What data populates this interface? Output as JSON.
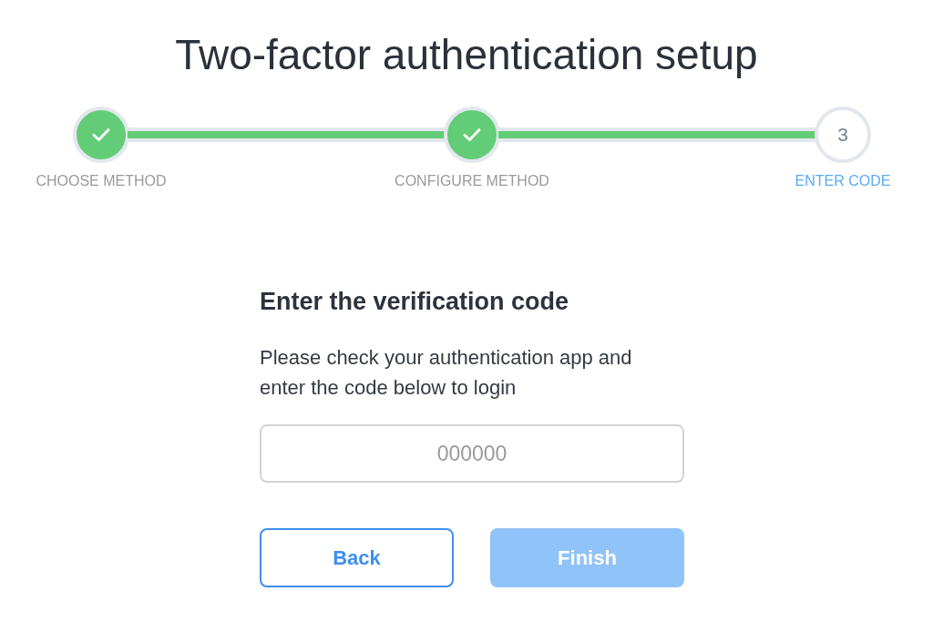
{
  "title": "Two-factor authentication setup",
  "stepper": {
    "steps": [
      {
        "label": "CHOOSE METHOD",
        "completed": true,
        "selected": false
      },
      {
        "label": "CONFIGURE METHOD",
        "completed": true,
        "selected": false
      },
      {
        "label": "ENTER CODE",
        "completed": false,
        "selected": true,
        "number": "3"
      }
    ],
    "connectors": [
      {
        "level": 1
      },
      {
        "level": 1
      }
    ]
  },
  "form": {
    "heading": "Enter the verification code",
    "instructions": "Please check your authentication app and enter the code below to login",
    "code_field": {
      "placeholder": "000000"
    },
    "buttons": [
      {
        "label": "Back",
        "kind": "secondary",
        "disabled": false
      },
      {
        "label": "Finish",
        "kind": "primary",
        "disabled": true
      }
    ]
  }
}
